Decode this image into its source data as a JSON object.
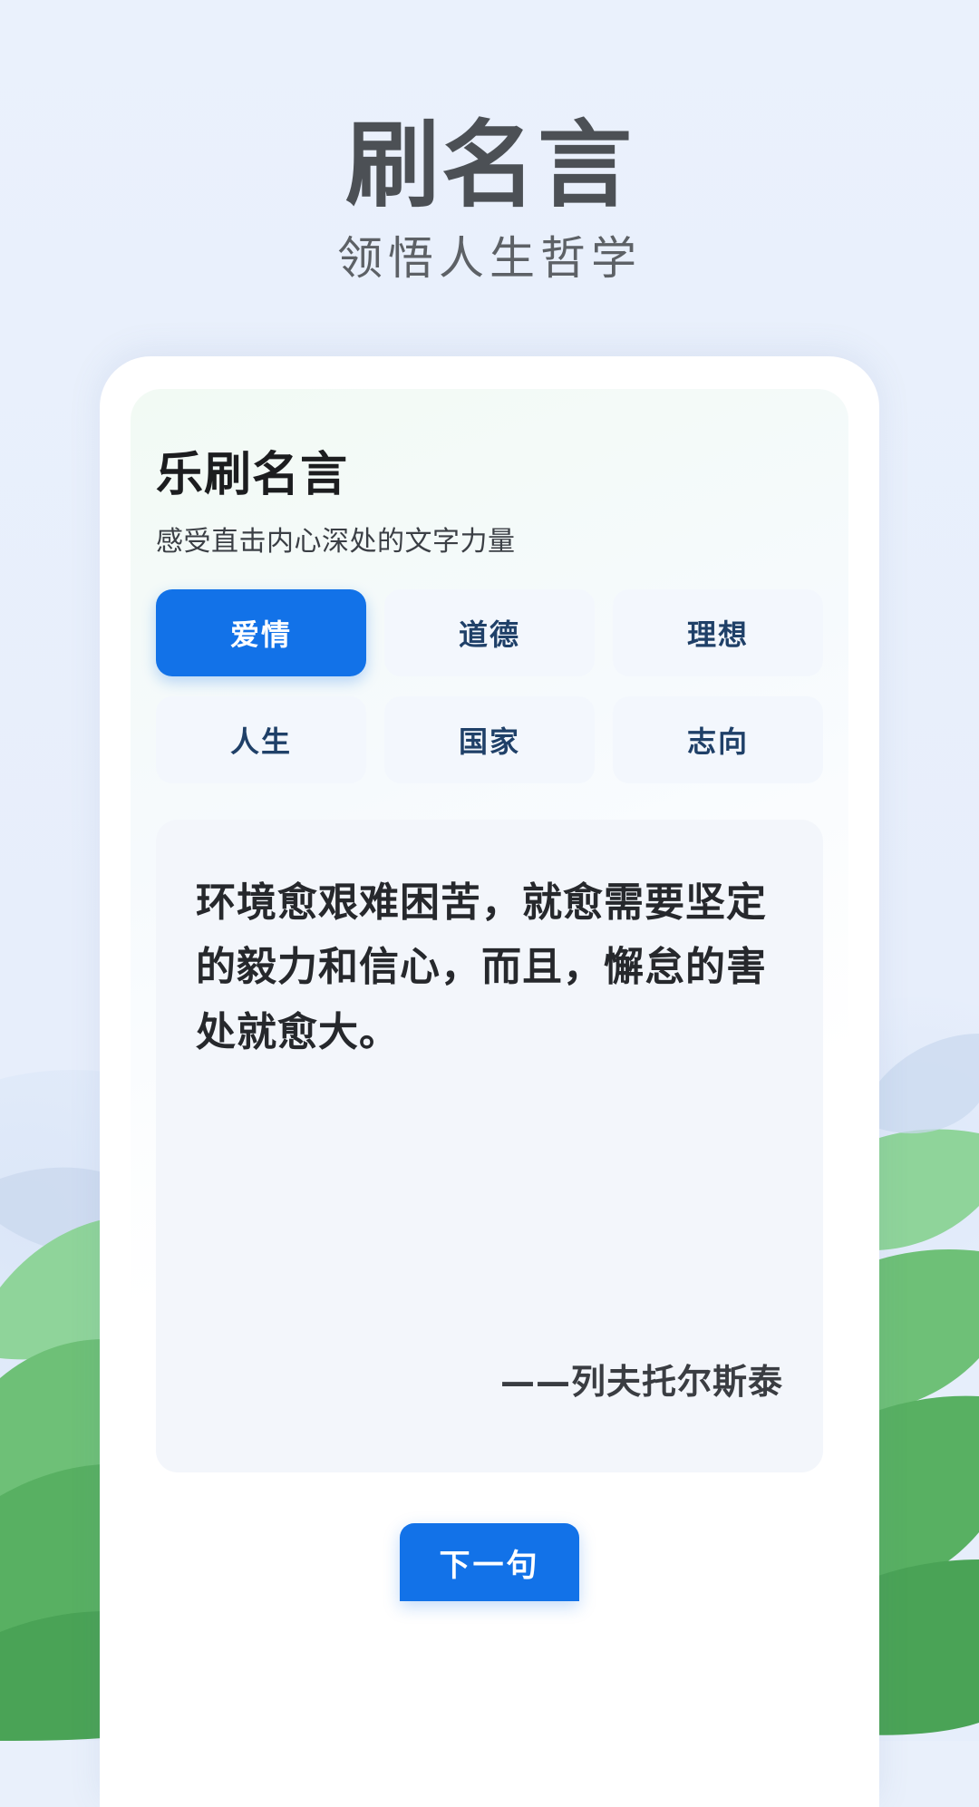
{
  "header": {
    "title": "刷名言",
    "subtitle": "领悟人生哲学",
    "title_color": "#4c5055",
    "subtitle_color": "#5d6166"
  },
  "card": {
    "title": "乐刷名言",
    "subtitle": "感受直击内心深处的文字力量"
  },
  "categories": [
    {
      "label": "爱情",
      "selected": true
    },
    {
      "label": "道德",
      "selected": false
    },
    {
      "label": "理想",
      "selected": false
    },
    {
      "label": "人生",
      "selected": false
    },
    {
      "label": "国家",
      "selected": false
    },
    {
      "label": "志向",
      "selected": false
    }
  ],
  "quote": {
    "text": "环境愈艰难困苦，就愈需要坚定的毅力和信心，而且，懈怠的害处就愈大。",
    "author": "——列夫托尔斯泰"
  },
  "actions": {
    "next_label": "下一句"
  },
  "theme": {
    "page_background": "#e9f0fb",
    "accent": "#1272e8",
    "chip_background": "#f3f7fd",
    "chip_text": "#1f4068",
    "quote_panel_background": "#f3f6fb",
    "leaf_green": "#66bb6a",
    "leaf_green_dark": "#4fa356",
    "leaf_green_light": "#8fd49a"
  }
}
